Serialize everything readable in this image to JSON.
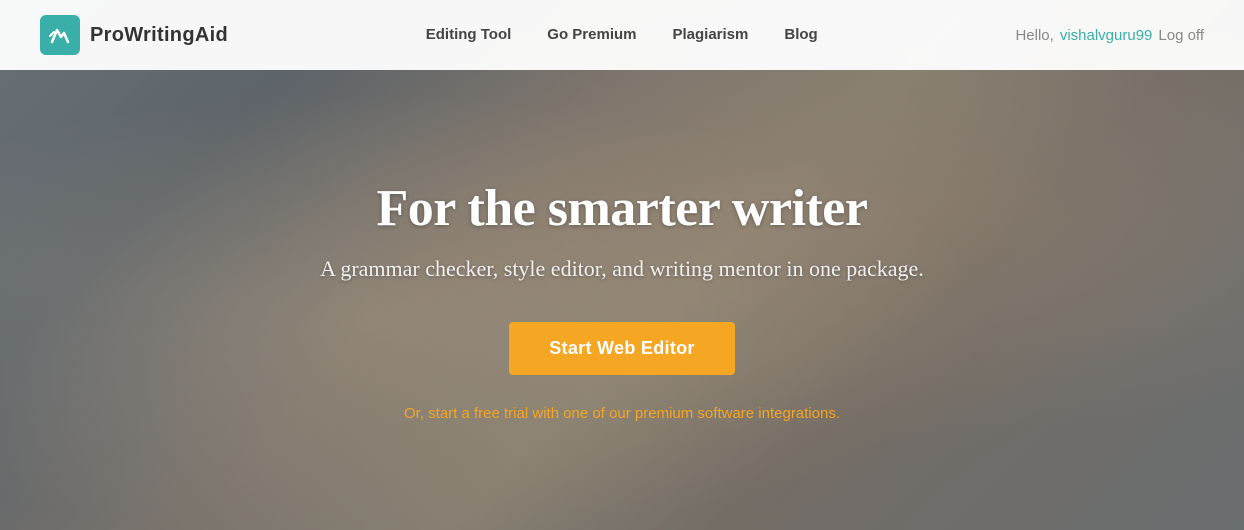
{
  "brand": {
    "name": "ProWritingAid",
    "logo_alt": "ProWritingAid logo"
  },
  "navbar": {
    "links": [
      {
        "id": "editing-tool",
        "label": "Editing Tool"
      },
      {
        "id": "go-premium",
        "label": "Go Premium"
      },
      {
        "id": "plagiarism",
        "label": "Plagiarism"
      },
      {
        "id": "blog",
        "label": "Blog"
      }
    ],
    "user": {
      "greeting": "Hello,",
      "username": "vishalvguru99",
      "logoff_label": "Log off"
    }
  },
  "hero": {
    "title": "For the smarter writer",
    "subtitle": "A grammar checker, style editor, and writing mentor in one package.",
    "cta_label": "Start Web Editor",
    "secondary_text": "Or, start a free trial with one of our premium software integrations."
  }
}
